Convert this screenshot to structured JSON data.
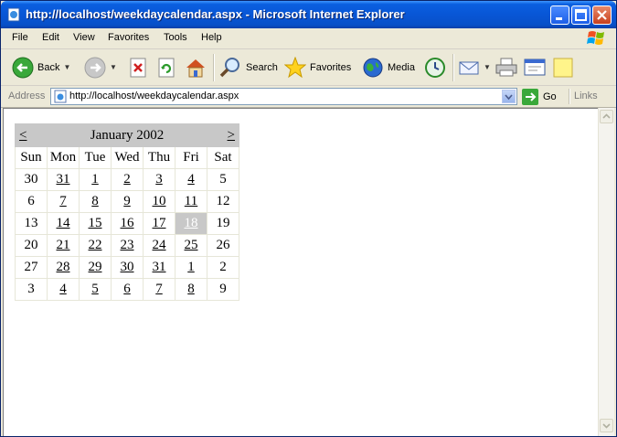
{
  "window": {
    "title": "http://localhost/weekdaycalendar.aspx - Microsoft Internet Explorer"
  },
  "menu": [
    "File",
    "Edit",
    "View",
    "Favorites",
    "Tools",
    "Help"
  ],
  "toolbar": {
    "back": "Back",
    "search": "Search",
    "favorites": "Favorites",
    "media": "Media"
  },
  "address": {
    "label": "Address",
    "url": "http://localhost/weekdaycalendar.aspx",
    "go": "Go",
    "links": "Links"
  },
  "calendar": {
    "prev": "<",
    "next": ">",
    "month_title": "January 2002",
    "days": [
      "Sun",
      "Mon",
      "Tue",
      "Wed",
      "Thu",
      "Fri",
      "Sat"
    ],
    "weeks": [
      [
        "30",
        "31",
        "1",
        "2",
        "3",
        "4",
        "5"
      ],
      [
        "6",
        "7",
        "8",
        "9",
        "10",
        "11",
        "12"
      ],
      [
        "13",
        "14",
        "15",
        "16",
        "17",
        "18",
        "19"
      ],
      [
        "20",
        "21",
        "22",
        "23",
        "24",
        "25",
        "26"
      ],
      [
        "27",
        "28",
        "29",
        "30",
        "31",
        "1",
        "2"
      ],
      [
        "3",
        "4",
        "5",
        "6",
        "7",
        "8",
        "9"
      ]
    ],
    "selected_date": "18"
  },
  "colors": {
    "titlebar": "#0856d6",
    "calendar_header": "#c8c8c8",
    "selected_text": "#ffffff"
  }
}
